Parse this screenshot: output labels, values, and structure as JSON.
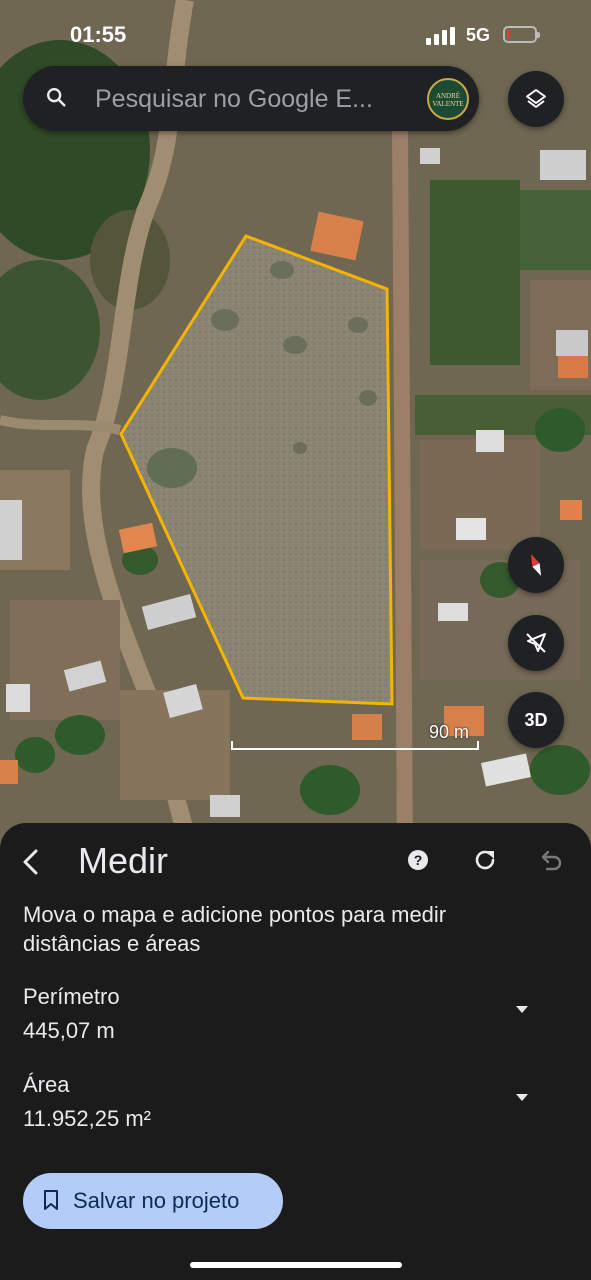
{
  "status_bar": {
    "time": "01:55",
    "network": "5G",
    "battery_level": 0.1
  },
  "search": {
    "placeholder": "Pesquisar no Google E...",
    "avatar_text_line1": "ANDRÉ",
    "avatar_text_line2": "VALENTE"
  },
  "map": {
    "scale_label": "90 m",
    "three_d_label": "3D",
    "polygon_color": "#f4b400"
  },
  "measure_panel": {
    "title": "Medir",
    "instruction": "Mova o mapa e adicione pontos para medir distâncias e áreas",
    "perimeter_label": "Perímetro",
    "perimeter_value": "445,07 m",
    "area_label": "Área",
    "area_value": "11.952,25 m²",
    "save_button_label": "Salvar no projeto",
    "accent_color": "#b3cdf6"
  },
  "icons": {
    "back": "chevron-left-icon",
    "help": "help-icon",
    "redo": "redo-icon",
    "undo": "undo-icon",
    "layers": "layers-icon",
    "compass": "compass-icon",
    "location": "location-off-icon",
    "search": "search-icon",
    "bookmark": "bookmark-icon"
  }
}
